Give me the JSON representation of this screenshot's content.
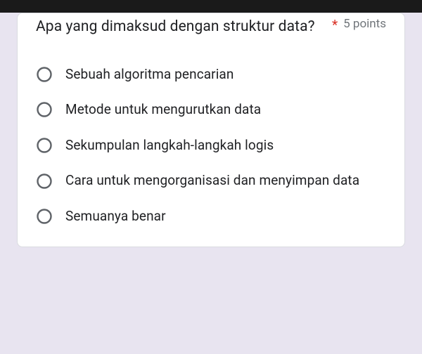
{
  "question": {
    "text": "Apa yang dimaksud dengan struktur data?",
    "required_marker": "*",
    "points_label": "5 points"
  },
  "options": [
    {
      "label": "Sebuah algoritma pencarian"
    },
    {
      "label": "Metode untuk mengurutkan data"
    },
    {
      "label": "Sekumpulan langkah-langkah logis"
    },
    {
      "label": "Cara untuk mengorganisasi dan menyimpan data"
    },
    {
      "label": "Semuanya benar"
    }
  ]
}
